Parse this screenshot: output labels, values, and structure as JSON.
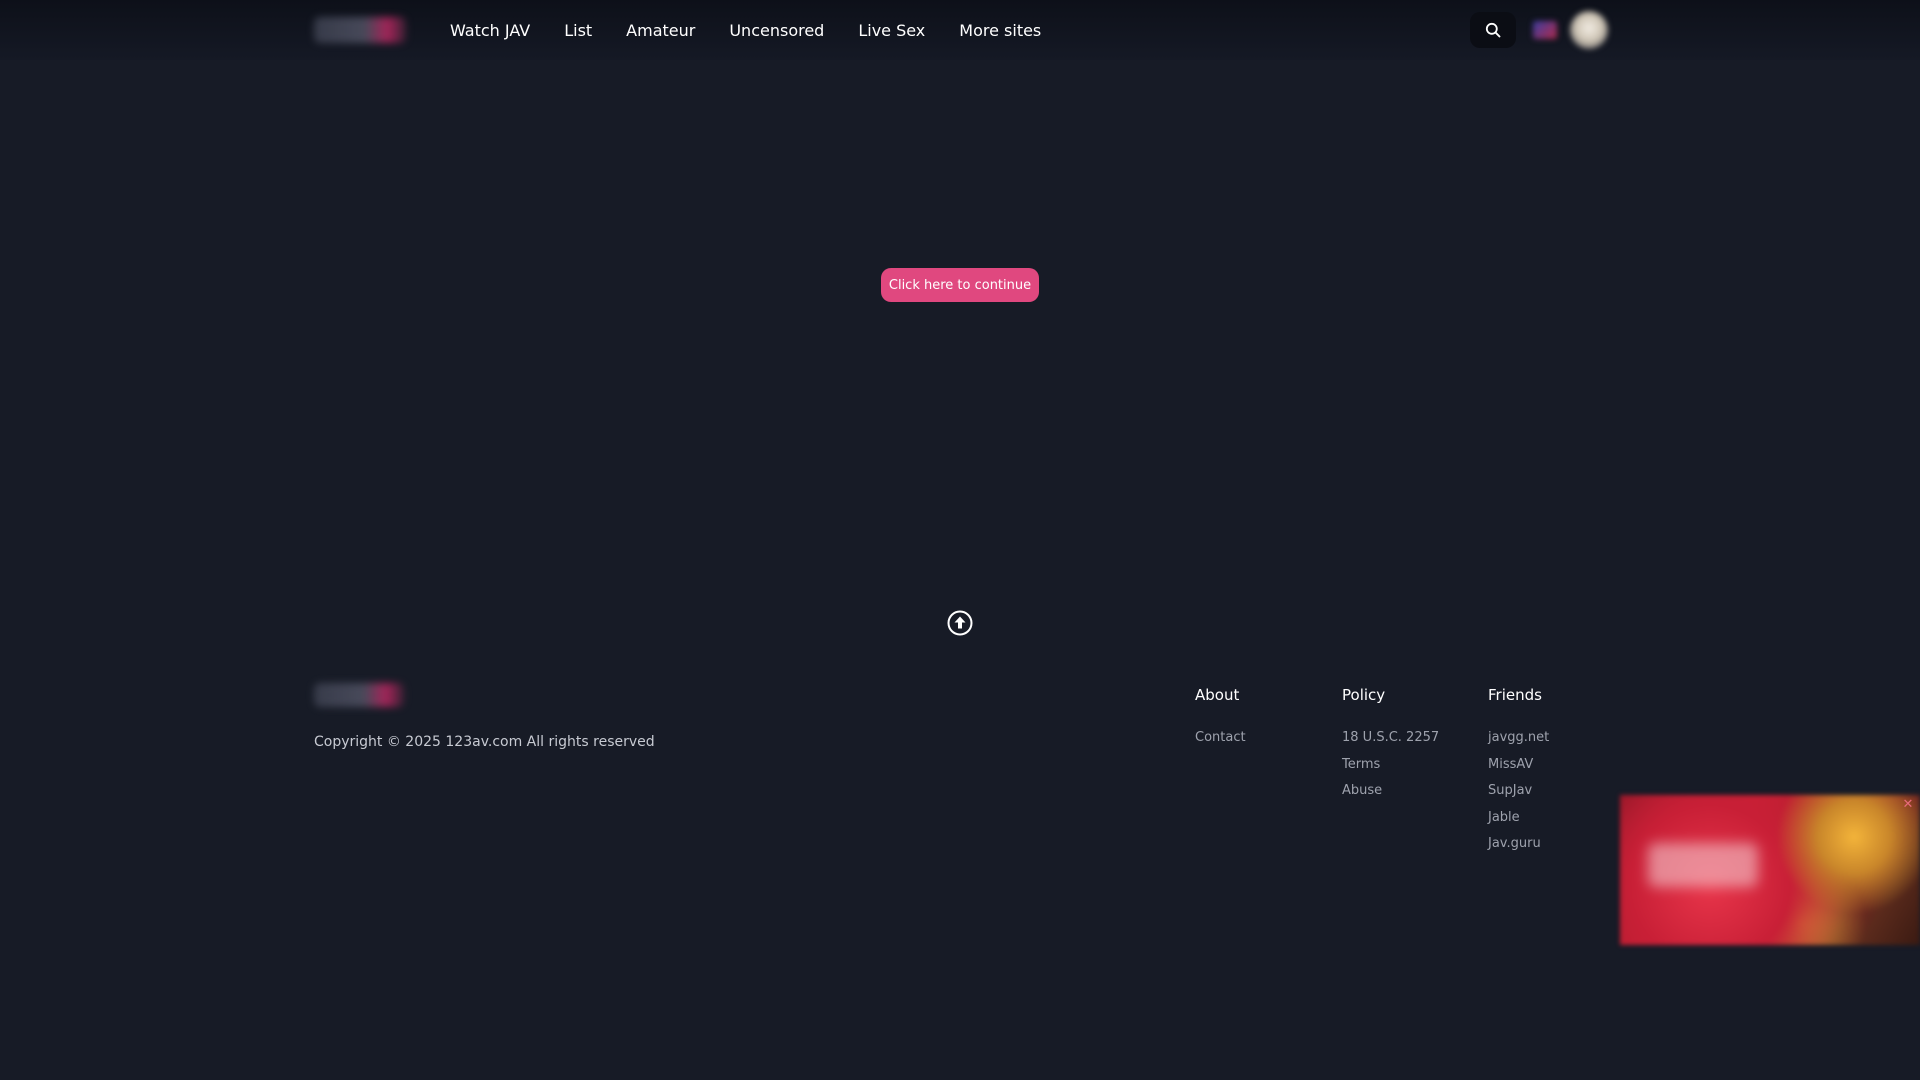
{
  "header": {
    "nav": [
      {
        "label": "Watch JAV"
      },
      {
        "label": "List"
      },
      {
        "label": "Amateur"
      },
      {
        "label": "Uncensored"
      },
      {
        "label": "Live Sex"
      },
      {
        "label": "More sites"
      }
    ],
    "search_icon": "search-icon"
  },
  "main": {
    "continue_label": "Click here to continue",
    "back_to_top_icon": "arrow-up-circle-icon"
  },
  "footer": {
    "copyright": "Copyright © 2025 123av.com All rights reserved",
    "columns": [
      {
        "title": "About",
        "links": [
          "Contact"
        ]
      },
      {
        "title": "Policy",
        "links": [
          "18 U.S.C. 2257",
          "Terms",
          "Abuse"
        ]
      },
      {
        "title": "Friends",
        "links": [
          "javgg.net",
          "MissAV",
          "SupJav",
          "Jable",
          "Jav.guru"
        ]
      }
    ]
  },
  "ad": {
    "close_icon": "close-icon"
  },
  "colors": {
    "background": "#171b26",
    "header_background": "#0d1019",
    "accent": "#e0487f",
    "muted_text": "#9ea2ad"
  }
}
